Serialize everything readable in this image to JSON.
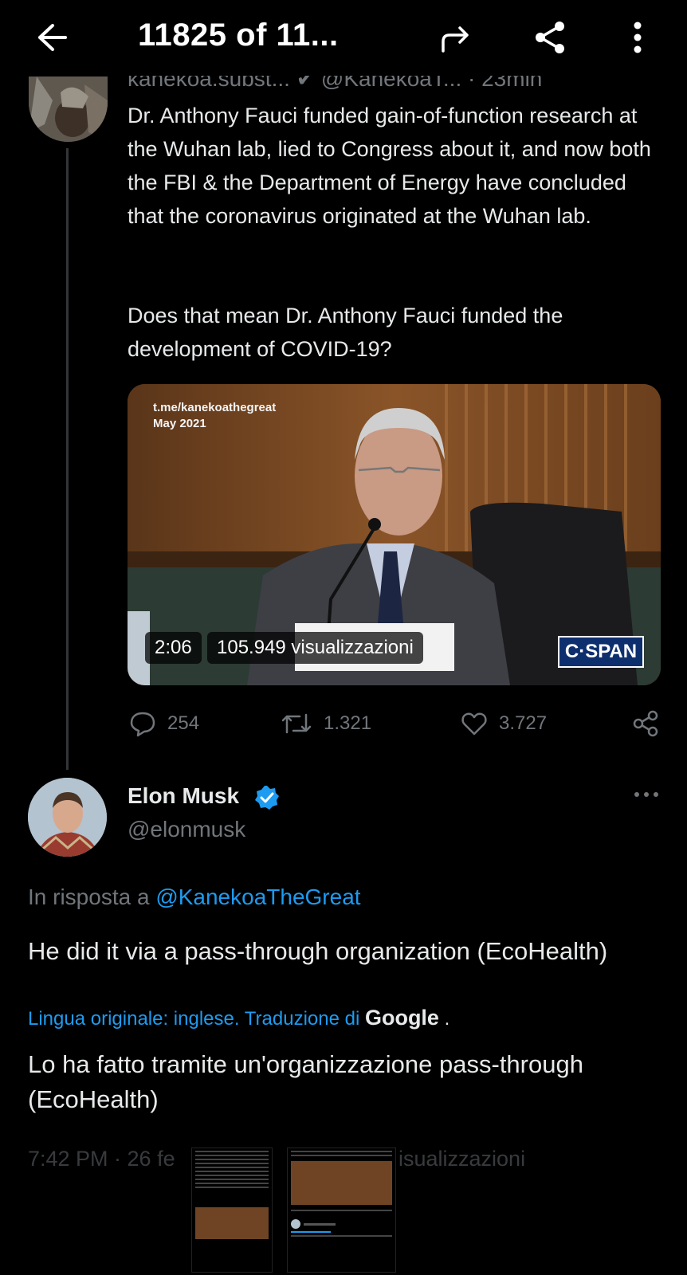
{
  "topbar": {
    "counter": "11825 of 11...",
    "back_icon": "back-arrow-icon",
    "forward_icon": "forward-arrow-icon",
    "share_icon": "share-icon",
    "more_icon": "more-vertical-icon"
  },
  "previous_tweet": {
    "header_partial": "kanekoa.subst... ✔ @KanekoaT... · 23min",
    "text_p1": "Dr. Anthony Fauci funded gain-of-function research at the Wuhan lab, lied to Congress about it, and now both the FBI & the Department of Energy have concluded that the coronavirus originated at the Wuhan lab.",
    "text_p2": "Does that mean Dr. Anthony Fauci funded the development of COVID-19?",
    "media": {
      "source_line1": "t.me/kanekoathegreat",
      "source_line2": "May 2021",
      "duration": "2:06",
      "views": "105.949 visualizzazioni",
      "logo": "C·SPAN"
    },
    "actions": {
      "replies": "254",
      "retweets": "1.321",
      "likes": "3.727"
    }
  },
  "main_tweet": {
    "author_name": "Elon Musk",
    "author_handle": "@elonmusk",
    "reply_prefix": "In risposta a ",
    "reply_mention": "@KanekoaTheGreat",
    "text": "He did it via a pass-through organization (EcoHealth)",
    "translation_note": "Lingua originale: inglese. Traduzione di ",
    "translation_provider": "Google",
    "translation_suffix": " .",
    "translated_text": "Lo ha fatto tramite un'organizzazione pass-through (EcoHealth)",
    "timestamp": "7:42 PM · 26 fe",
    "views_tail": "isualizzazioni"
  },
  "colors": {
    "background": "#000000",
    "text": "#e7e9ea",
    "muted": "#71767b",
    "link": "#1d9bf0",
    "verified": "#1d9bf0"
  }
}
